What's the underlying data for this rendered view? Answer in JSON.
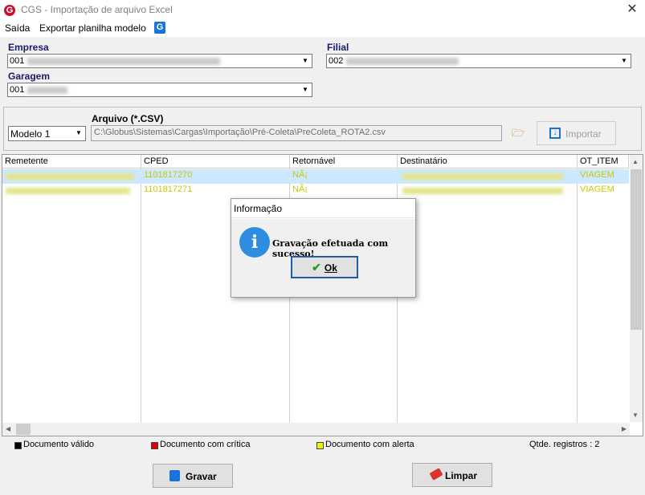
{
  "window": {
    "title": "CGS - Importação de arquivo Excel",
    "logo_letter": "G"
  },
  "menu": {
    "items": [
      "Saída",
      "Exportar planilha modelo"
    ],
    "export_icon_letter": "G"
  },
  "empresa": {
    "label": "Empresa",
    "code": "001"
  },
  "filial": {
    "label": "Filial",
    "code": "002"
  },
  "garagem": {
    "label": "Garagem",
    "code": "001"
  },
  "arquivo": {
    "label": "Arquivo (*.CSV)",
    "model_selected": "Modelo 1",
    "path": "C:\\Globus\\Sistemas\\Cargas\\Importação\\Pré-Coleta\\PreColeta_ROTA2.csv",
    "import_label": "Importar"
  },
  "grid": {
    "columns": [
      "Remetente",
      "CPED",
      "Retornável",
      "Destinatário",
      "OT_ITEM"
    ],
    "rows": [
      {
        "cped": "1101817270",
        "retornavel": "NÃ¡",
        "ot_item": "VIAGEM"
      },
      {
        "cped": "1101817271",
        "retornavel": "NÃ¡",
        "ot_item": "VIAGEM"
      }
    ],
    "row_text_color": "#c9c900",
    "selected_row_color": "#cce8ff"
  },
  "legend": {
    "items": [
      {
        "label": "Documento válido",
        "color": "#000000"
      },
      {
        "label": "Documento com crítica",
        "color": "#e00000"
      },
      {
        "label": "Documento com alerta",
        "color": "#f2f200"
      }
    ],
    "count_text": "Qtde. registros : 2"
  },
  "buttons": {
    "gravar": "Gravar",
    "limpar": "Limpar"
  },
  "dialog": {
    "title": "Informação",
    "message": "Gravação efetuada com sucesso!",
    "ok_label": "Ok"
  }
}
